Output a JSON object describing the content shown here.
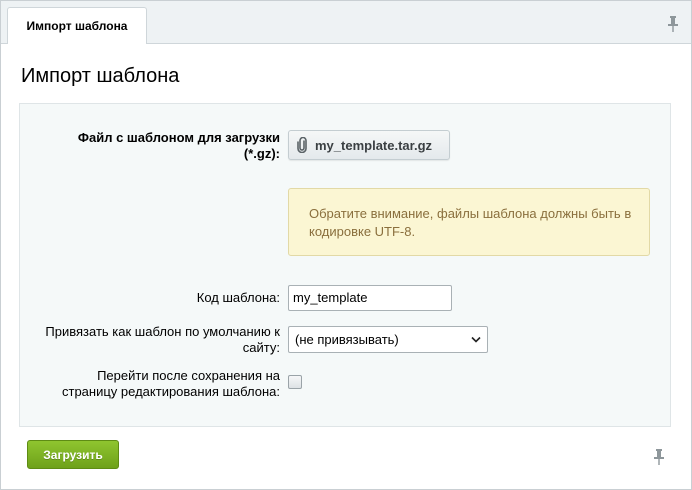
{
  "tab": {
    "label": "Импорт шаблона"
  },
  "page": {
    "title": "Импорт шаблона"
  },
  "form": {
    "file_label": "Файл с шаблоном для загрузки (*.gz):",
    "file_name": "my_template.tar.gz",
    "notice": "Обратите внимание, файлы шаблона должны быть в кодировке UTF-8.",
    "code_label": "Код шаблона:",
    "code_value": "my_template",
    "bind_label": "Привязать как шаблон по умолчанию к сайту:",
    "bind_selected": "(не привязывать)",
    "redirect_label": "Перейти после сохранения на страницу редактирования шаблона:",
    "redirect_checked": false
  },
  "actions": {
    "submit_label": "Загрузить"
  },
  "icons": {
    "pin": "pin-icon",
    "paperclip": "paperclip-icon",
    "dropdown": "chevron-down-icon"
  },
  "colors": {
    "accent_green": "#7cb224",
    "notice_bg": "#fbf6d3",
    "notice_text": "#8a6f3d"
  }
}
